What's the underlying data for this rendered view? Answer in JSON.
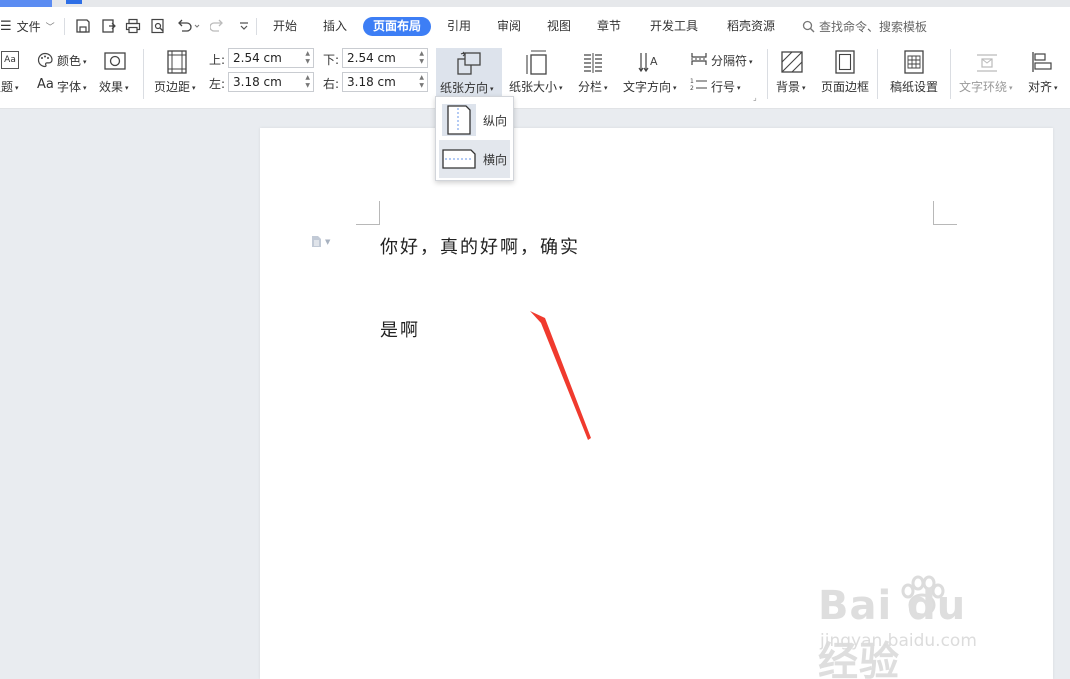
{
  "menubar": {
    "file_label": "文件",
    "tabs": [
      "开始",
      "插入",
      "页面布局",
      "引用",
      "审阅",
      "视图",
      "章节",
      "开发工具",
      "稻壳资源"
    ],
    "active_tab": "页面布局",
    "search_placeholder": "查找命令、搜索模板"
  },
  "ribbon": {
    "theme_label": "主题",
    "color_label": "颜色",
    "font_label": "字体",
    "font_icon_text": "Aa",
    "theme_icon_text": "Aa",
    "effect_label": "效果",
    "margins_label": "页边距",
    "margin_top_label": "上:",
    "margin_top_value": "2.54 cm",
    "margin_bottom_label": "下:",
    "margin_bottom_value": "2.54 cm",
    "margin_left_label": "左:",
    "margin_left_value": "3.18 cm",
    "margin_right_label": "右:",
    "margin_right_value": "3.18 cm",
    "orientation_label": "纸张方向",
    "size_label": "纸张大小",
    "columns_label": "分栏",
    "text_direction_label": "文字方向",
    "separator_label": "分隔符",
    "line_number_label": "行号",
    "background_label": "背景",
    "page_border_label": "页面边框",
    "paper_setup_label": "稿纸设置",
    "text_wrap_label": "文字环绕",
    "align_label": "对齐"
  },
  "orientation_menu": {
    "items": [
      {
        "label": "纵向",
        "icon": "portrait-page-icon"
      },
      {
        "label": "横向",
        "icon": "landscape-page-icon"
      }
    ],
    "highlighted": "横向"
  },
  "document": {
    "line1": "你好，真的好啊，确实",
    "line2": "是啊"
  },
  "watermark": {
    "brand": "Bai du 经验",
    "url": "jingyan.baidu.com"
  },
  "colors": {
    "accent": "#3d7ef5",
    "arrow": "#f03a2e"
  }
}
